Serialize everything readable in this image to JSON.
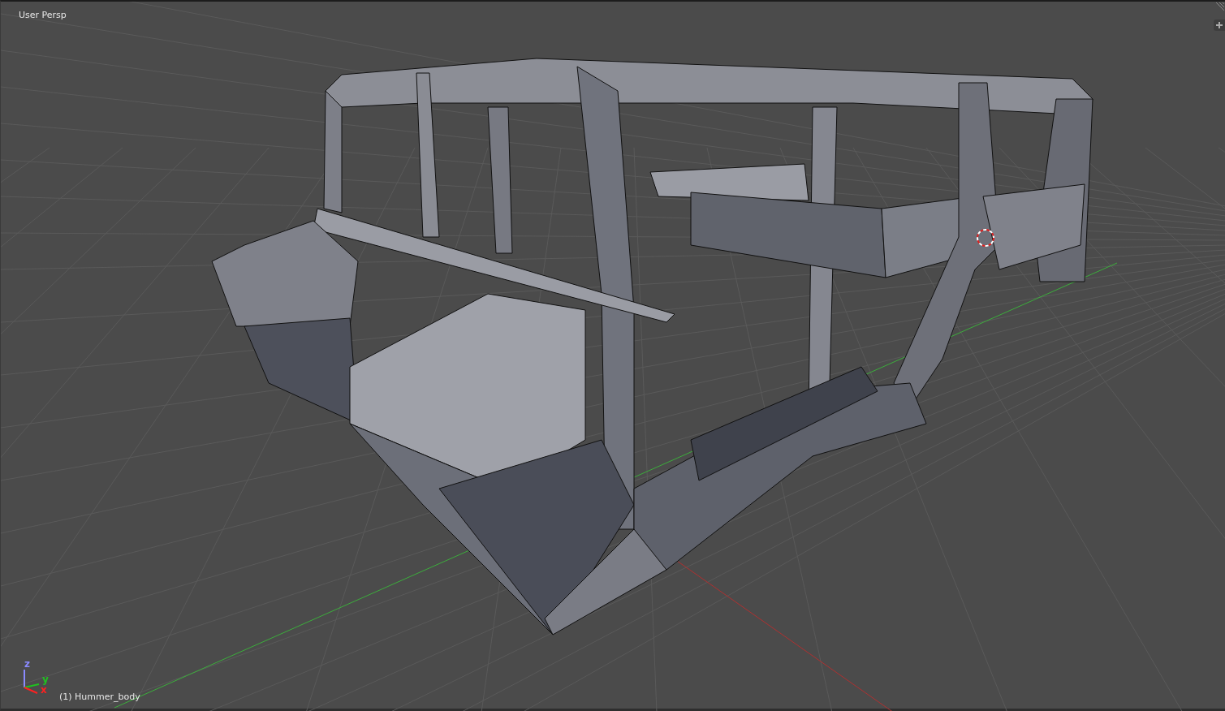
{
  "viewport": {
    "view_name": "User Persp",
    "object_label": "(1) Hummer_body",
    "gizmo_axes": [
      {
        "kind": "z",
        "label": "z"
      },
      {
        "kind": "y",
        "label": "y"
      },
      {
        "kind": "x",
        "label": "x"
      }
    ]
  }
}
